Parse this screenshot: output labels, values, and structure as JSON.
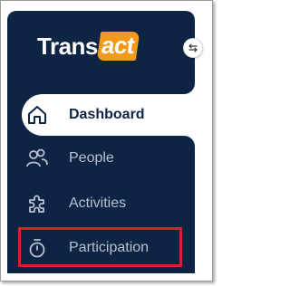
{
  "brand": {
    "name_main": "Trans",
    "name_accent": "act",
    "accent_color": "#f39a1b",
    "sidebar_color": "#0d2444"
  },
  "sidebar": {
    "toggle_icon": "collapse-arrows-icon",
    "items": [
      {
        "label": "Dashboard",
        "icon": "home-icon",
        "active": true
      },
      {
        "label": "People",
        "icon": "people-icon",
        "active": false
      },
      {
        "label": "Activities",
        "icon": "puzzle-icon",
        "active": false
      },
      {
        "label": "Participation",
        "icon": "stopwatch-icon",
        "active": false,
        "highlighted": true
      }
    ]
  },
  "annotation": {
    "highlight_color": "#d6202a"
  }
}
